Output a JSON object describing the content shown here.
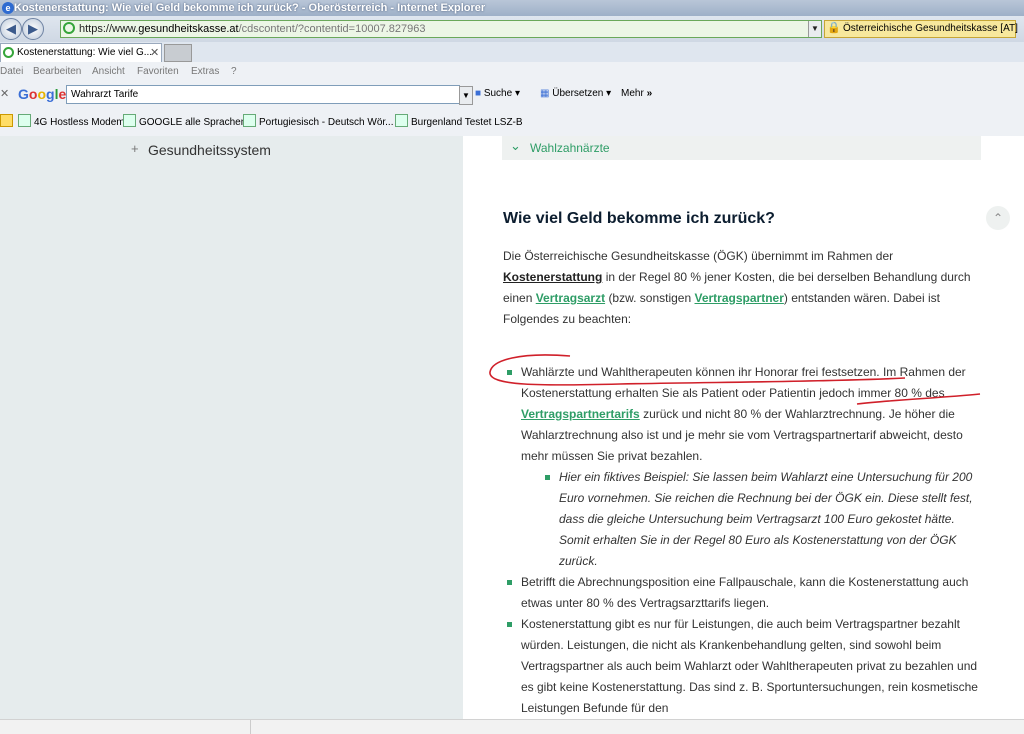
{
  "browser": {
    "window_title": "Kostenerstattung: Wie viel Geld bekomme ich zurück? - Oberösterreich - Internet Explorer",
    "address": {
      "scheme": "https://www.",
      "domain": "gesundheitskasse.at",
      "path": "/cdscontent/?contentid=10007.827963"
    },
    "cert_label": "Österreichische Gesundheitskasse [AT]",
    "tab_title": "Kostenerstattung: Wie viel G...",
    "menu": [
      "Datei",
      "Bearbeiten",
      "Ansicht",
      "Favoriten",
      "Extras",
      "?"
    ],
    "google_toolbar": {
      "logo": "Google",
      "search_value": "Wahrarzt Tarife",
      "search_label": "Suche",
      "translate_label": "Übersetzen",
      "more_label": "Mehr"
    },
    "favorites": [
      "4G Hostless Modem",
      "GOOGLE alle Sprachen",
      "Portugiesisch - Deutsch Wör...",
      "Burgenland Testet  LSZ-B"
    ]
  },
  "sidebar": {
    "item_label": "Gesundheitssystem"
  },
  "accordion": {
    "label": "Wahlzahnärzte"
  },
  "content": {
    "heading": "Wie viel Geld bekomme ich zurück?",
    "intro": {
      "p1": "Die Österreichische Gesundheitskasse (ÖGK) übernimmt im Rahmen der",
      "link1": "Kostenerstattung",
      "p2": "in der Regel 80 % jener Kosten, die bei derselben Behandlung durch einen",
      "link2": "Vertragsarzt",
      "p3": "(bzw. sonstigen",
      "link3": "Vertragspartner",
      "p4": ") entstanden wären. Dabei ist Folgendes zu beachten:"
    },
    "bullet1": {
      "t1": "Wahlärzte und Wahltherapeuten können ihr Honorar frei festsetzen. Im Rahmen der Kostenerstattung erhalten Sie als Patient oder Patientin jedoch immer 80 % des",
      "link": "Vertragspartnertarifs",
      "t2": "zurück und nicht 80 % der Wahlarztrechnung. Je höher die Wahlarztrechnung also ist und je mehr sie vom Vertragspartnertarif abweicht, desto mehr müssen Sie privat bezahlen."
    },
    "sub_bullet": "Hier ein fiktives Beispiel: Sie lassen beim Wahlarzt eine Untersuchung für 200 Euro vornehmen. Sie reichen die Rechnung bei der ÖGK ein. Diese stellt fest, dass die gleiche Untersuchung beim Vertragsarzt 100 Euro gekostet hätte. Somit erhalten Sie in der Regel 80 Euro als Kostenerstattung von der ÖGK zurück.",
    "bullet2": "Betrifft die Abrechnungsposition eine Fallpauschale, kann die Kostenerstattung auch etwas unter 80 % des Vertragsarzttarifs liegen.",
    "bullet3": "Kostenerstattung gibt es nur für Leistungen, die auch beim Vertragspartner bezahlt würden. Leistungen, die nicht als Krankenbehandlung gelten, sind sowohl beim Vertragspartner als auch beim Wahlarzt oder Wahltherapeuten privat zu bezahlen und es gibt keine Kostenerstattung. Das sind z. B. Sportuntersuchungen, rein kosmetische Leistungen Befunde für den"
  },
  "colors": {
    "accent_green": "#2e9d66",
    "annotation_red": "#d0202a",
    "heading": "#0c1d2f"
  }
}
